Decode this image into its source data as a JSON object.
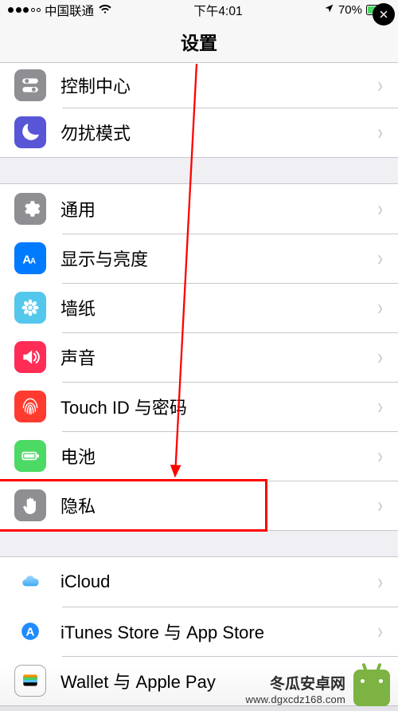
{
  "status": {
    "carrier": "中国联通",
    "time": "下午4:01",
    "battery_pct": "70%"
  },
  "nav": {
    "title": "设置"
  },
  "groups": [
    {
      "rows": [
        {
          "key": "controlcenter",
          "label": "控制中心",
          "icon": "toggles-icon",
          "bg": "ic-controlcenter"
        },
        {
          "key": "dnd",
          "label": "勿扰模式",
          "icon": "moon-icon",
          "bg": "ic-dnd"
        }
      ]
    },
    {
      "rows": [
        {
          "key": "general",
          "label": "通用",
          "icon": "gear-icon",
          "bg": "ic-general"
        },
        {
          "key": "display",
          "label": "显示与亮度",
          "icon": "text-size-icon",
          "bg": "ic-display"
        },
        {
          "key": "wallpaper",
          "label": "墙纸",
          "icon": "flower-icon",
          "bg": "ic-wallpaper"
        },
        {
          "key": "sound",
          "label": "声音",
          "icon": "speaker-icon",
          "bg": "ic-sound"
        },
        {
          "key": "touchid",
          "label": "Touch ID 与密码",
          "icon": "fingerprint-icon",
          "bg": "ic-touchid"
        },
        {
          "key": "battery",
          "label": "电池",
          "icon": "battery-icon",
          "bg": "ic-battery"
        },
        {
          "key": "privacy",
          "label": "隐私",
          "icon": "hand-icon",
          "bg": "ic-privacy"
        }
      ]
    },
    {
      "rows": [
        {
          "key": "icloud",
          "label": "iCloud",
          "icon": "cloud-icon",
          "bg": "ic-icloud"
        },
        {
          "key": "itunes",
          "label": "iTunes Store 与 App Store",
          "icon": "appstore-icon",
          "bg": "ic-itunes"
        },
        {
          "key": "wallet",
          "label": "Wallet 与 Apple Pay",
          "icon": "wallet-icon",
          "bg": "ic-wallet"
        }
      ]
    }
  ],
  "annotation": {
    "highlight_row": "privacy"
  },
  "watermark": {
    "brand": "冬瓜安卓网",
    "url": "www.dgxcdz168.com"
  }
}
